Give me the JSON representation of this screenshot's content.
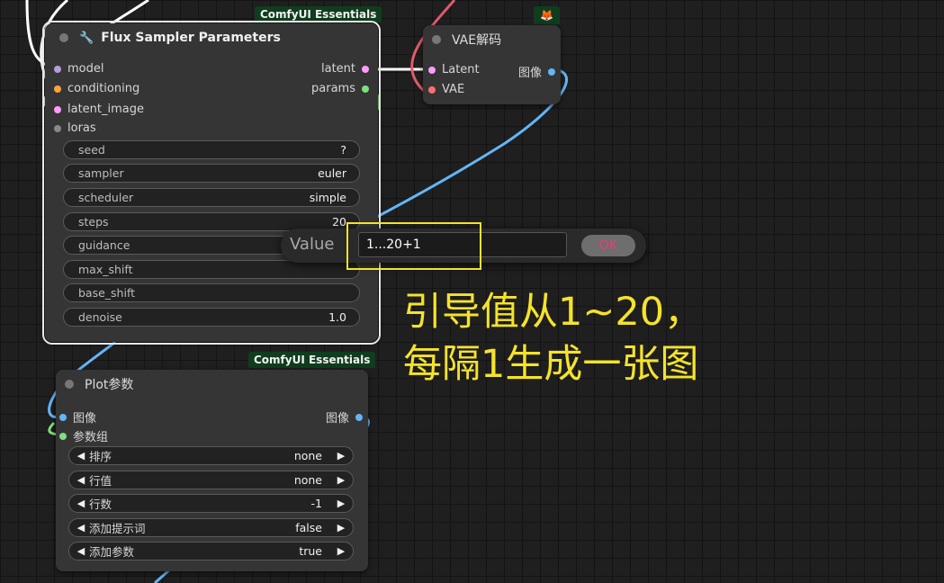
{
  "sampler_node": {
    "badge": "ComfyUI Essentials",
    "title": "Flux Sampler Parameters",
    "inputs": [
      {
        "label": "model",
        "color": "#b39ddb"
      },
      {
        "label": "conditioning",
        "color": "#ffa040"
      },
      {
        "label": "latent_image",
        "color": "#ff9cf9"
      },
      {
        "label": "loras",
        "color": "#888888"
      }
    ],
    "outputs": [
      {
        "label": "latent",
        "color": "#ff9cf9"
      },
      {
        "label": "params",
        "color": "#7ee07e"
      }
    ],
    "widgets": [
      {
        "name": "seed",
        "value": "?"
      },
      {
        "name": "sampler",
        "value": "euler"
      },
      {
        "name": "scheduler",
        "value": "simple"
      },
      {
        "name": "steps",
        "value": "20"
      },
      {
        "name": "guidance",
        "value": ""
      },
      {
        "name": "max_shift",
        "value": ""
      },
      {
        "name": "base_shift",
        "value": ""
      },
      {
        "name": "denoise",
        "value": "1.0"
      }
    ]
  },
  "vae_node": {
    "title": "VAE解码",
    "inputs": [
      {
        "label": "Latent",
        "color": "#ff9cf9"
      },
      {
        "label": "VAE",
        "color": "#ff6e6e"
      }
    ],
    "outputs": [
      {
        "label": "图像",
        "color": "#64b5f6"
      }
    ]
  },
  "plot_node": {
    "badge": "ComfyUI Essentials",
    "title": "Plot参数",
    "inputs": [
      {
        "label": "图像",
        "color": "#64b5f6"
      },
      {
        "label": "参数组",
        "color": "#7ee07e"
      }
    ],
    "outputs": [
      {
        "label": "图像",
        "color": "#64b5f6"
      }
    ],
    "combos": [
      {
        "name": "排序",
        "value": "none"
      },
      {
        "name": "行值",
        "value": "none"
      },
      {
        "name": "行数",
        "value": "-1"
      },
      {
        "name": "添加提示词",
        "value": "false"
      },
      {
        "name": "添加参数",
        "value": "true"
      }
    ]
  },
  "value_dialog": {
    "label": "Value",
    "input_value": "1...20+1",
    "ok_label": "OK"
  },
  "annotation": {
    "line1": "引导值从1~20，",
    "line2": "每隔1生成一张图"
  },
  "colors": {
    "highlight": "#f5e32a",
    "badge_bg": "#0f3d1e",
    "link_white": "#ffffff",
    "link_red": "#e05a6a",
    "link_blue": "#64b5f6"
  }
}
